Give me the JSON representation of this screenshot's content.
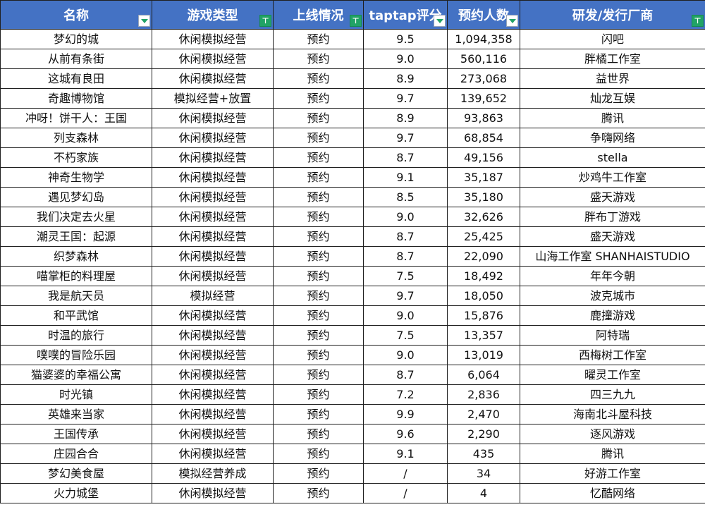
{
  "header": [
    {
      "label": "名称",
      "filter": "dropdown"
    },
    {
      "label": "游戏类型",
      "filter": "active"
    },
    {
      "label": "上线情况",
      "filter": "active"
    },
    {
      "label": "taptap评分",
      "filter": "dropdown"
    },
    {
      "label": "预约人数",
      "filter": "dropdown"
    },
    {
      "label": "研发/发行厂商",
      "filter": "active"
    }
  ],
  "rows": [
    [
      "梦幻的城",
      "休闲模拟经营",
      "预约",
      "9.5",
      "1,094,358",
      "闪吧"
    ],
    [
      "从前有条街",
      "休闲模拟经营",
      "预约",
      "9.0",
      "560,116",
      "胖橘工作室"
    ],
    [
      "这城有良田",
      "休闲模拟经营",
      "预约",
      "8.9",
      "273,068",
      "益世界"
    ],
    [
      "奇趣博物馆",
      "模拟经营+放置",
      "预约",
      "9.7",
      "139,652",
      "灿龙互娱"
    ],
    [
      "冲呀！饼干人：王国",
      "休闲模拟经营",
      "预约",
      "8.9",
      "93,863",
      "腾讯"
    ],
    [
      "列支森林",
      "休闲模拟经营",
      "预约",
      "9.7",
      "68,854",
      "争嗨网络"
    ],
    [
      "不朽家族",
      "休闲模拟经营",
      "预约",
      "8.7",
      "49,156",
      "stella"
    ],
    [
      "神奇生物学",
      "休闲模拟经营",
      "预约",
      "9.1",
      "35,187",
      "炒鸡牛工作室"
    ],
    [
      "遇见梦幻岛",
      "休闲模拟经营",
      "预约",
      "8.5",
      "35,180",
      "盛天游戏"
    ],
    [
      "我们决定去火星",
      "休闲模拟经营",
      "预约",
      "9.0",
      "32,626",
      "胖布丁游戏"
    ],
    [
      "潮灵王国：起源",
      "休闲模拟经营",
      "预约",
      "8.7",
      "25,425",
      "盛天游戏"
    ],
    [
      "织梦森林",
      "休闲模拟经营",
      "预约",
      "8.7",
      "22,090",
      "山海工作室 SHANHAISTUDIO"
    ],
    [
      "喵掌柜的料理屋",
      "休闲模拟经营",
      "预约",
      "7.5",
      "18,492",
      "年年今朝"
    ],
    [
      "我是航天员",
      "模拟经营",
      "预约",
      "9.7",
      "18,050",
      "波克城市"
    ],
    [
      "和平武馆",
      "休闲模拟经营",
      "预约",
      "9.0",
      "15,876",
      "鹿撞游戏"
    ],
    [
      "时温的旅行",
      "休闲模拟经营",
      "预约",
      "7.5",
      "13,357",
      "阿特瑞"
    ],
    [
      "噗噗的冒险乐园",
      "休闲模拟经营",
      "预约",
      "9.0",
      "13,019",
      "西梅树工作室"
    ],
    [
      "猫婆婆的幸福公寓",
      "休闲模拟经营",
      "预约",
      "8.7",
      "6,064",
      "曜灵工作室"
    ],
    [
      "时光镇",
      "休闲模拟经营",
      "预约",
      "7.2",
      "2,836",
      "四三九九"
    ],
    [
      "英雄来当家",
      "休闲模拟经营",
      "预约",
      "9.9",
      "2,470",
      "海南北斗屋科技"
    ],
    [
      "王国传承",
      "休闲模拟经营",
      "预约",
      "9.6",
      "2,290",
      "逐风游戏"
    ],
    [
      "庄园合合",
      "休闲模拟经营",
      "预约",
      "9.1",
      "435",
      "腾讯"
    ],
    [
      "梦幻美食屋",
      "模拟经营养成",
      "预约",
      "/",
      "34",
      "好游工作室"
    ],
    [
      "火力城堡",
      "休闲模拟经营",
      "预约",
      "/",
      "4",
      "忆酷网络"
    ]
  ],
  "colors": {
    "header_bg": "#4472c4",
    "header_text": "#ffffff",
    "filter_active": "#21a366"
  }
}
